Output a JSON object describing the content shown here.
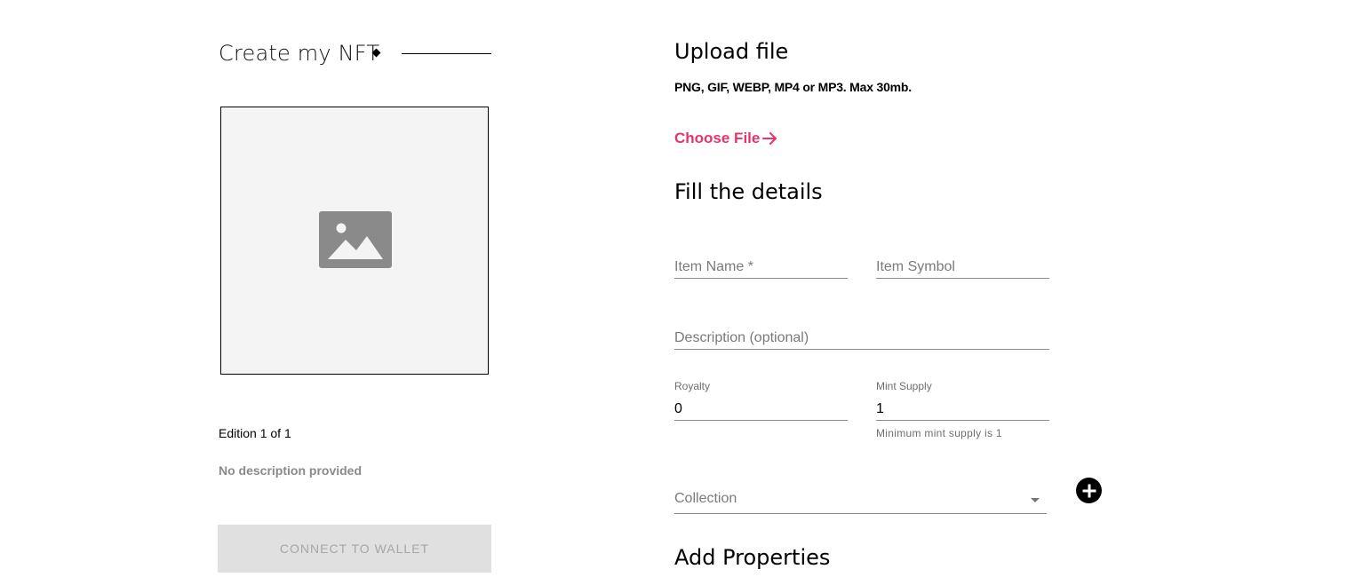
{
  "preview": {
    "title": "Create my NFT",
    "image_icon": "image-placeholder-icon",
    "edition": "Edition 1 of 1",
    "description": "No description provided",
    "connect_button": "CONNECT TO WALLET"
  },
  "upload": {
    "title": "Upload file",
    "hint": "PNG, GIF, WEBP, MP4 or MP3. Max 30mb.",
    "choose_file": "Choose File",
    "choose_file_icon": "arrow-right-icon"
  },
  "details": {
    "title": "Fill the details",
    "item_name_placeholder": "Item Name *",
    "item_symbol_placeholder": "Item Symbol",
    "description_placeholder": "Description (optional)",
    "royalty_label": "Royalty",
    "royalty_value": "0",
    "mint_supply_label": "Mint Supply",
    "mint_supply_value": "1",
    "mint_supply_helper": "Minimum mint supply is 1",
    "collection_placeholder": "Collection",
    "add_collection_icon": "plus-circle-icon"
  },
  "properties": {
    "title": "Add Properties"
  },
  "colors": {
    "accent": "#e8336b",
    "preview_bg": "#f4f4f4",
    "button_disabled_bg": "#e0e0e0"
  }
}
